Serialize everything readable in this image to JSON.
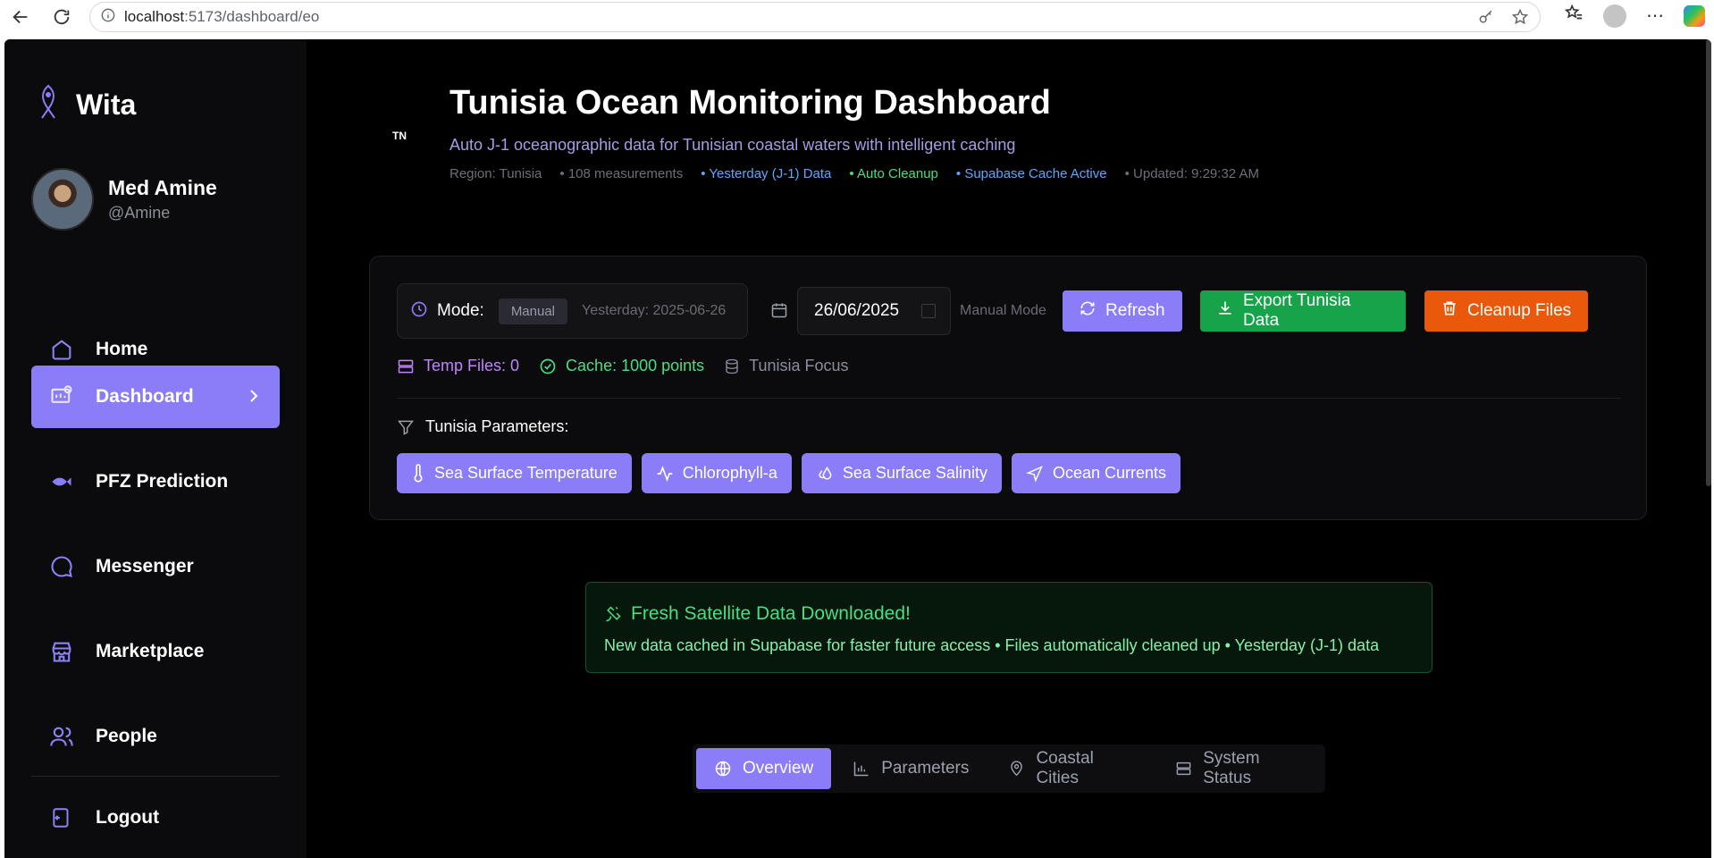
{
  "browser": {
    "url_host": "localhost",
    "url_path": ":5173/dashboard/eo"
  },
  "sidebar": {
    "brand": "Wita",
    "user": {
      "name": "Med Amine",
      "handle": "@Amine"
    },
    "items": [
      {
        "label": "Home",
        "icon": "home-icon"
      },
      {
        "label": "Dashboard",
        "icon": "dashboard-icon",
        "active": true
      },
      {
        "label": "PFZ Prediction",
        "icon": "fish-icon"
      },
      {
        "label": "Messenger",
        "icon": "chat-icon"
      },
      {
        "label": "Marketplace",
        "icon": "store-icon"
      },
      {
        "label": "People",
        "icon": "people-icon"
      }
    ],
    "logout": "Logout"
  },
  "header": {
    "badge": "TN",
    "title": "Tunisia Ocean Monitoring Dashboard",
    "subtitle": "Auto J-1 oceanographic data for Tunisian coastal waters with intelligent caching",
    "meta": {
      "region": "Region: Tunisia",
      "measurements": "108 measurements",
      "yesterday": "Yesterday (J-1) Data",
      "cleanup": "Auto Cleanup",
      "cache": "Supabase Cache Active",
      "updated": "Updated: 9:29:32 AM"
    }
  },
  "controls": {
    "mode_label": "Mode:",
    "mode_value": "Manual",
    "mode_yesterday": "Yesterday: 2025-06-26",
    "date": "26/06/2025",
    "manual_mode": "Manual Mode",
    "refresh": "Refresh",
    "export": "Export Tunisia Data",
    "cleanup": "Cleanup Files",
    "temp_files": "Temp Files: 0",
    "cache_points": "Cache: 1000 points",
    "focus": "Tunisia Focus",
    "params_label": "Tunisia Parameters:",
    "params": [
      "Sea Surface Temperature",
      "Chlorophyll-a",
      "Sea Surface Salinity",
      "Ocean Currents"
    ]
  },
  "alert": {
    "title": "Fresh Satellite Data Downloaded!",
    "body": "New data cached in Supabase for faster future access • Files automatically cleaned up • Yesterday (J-1) data"
  },
  "tabs": [
    "Overview",
    "Parameters",
    "Coastal Cities",
    "System Status"
  ],
  "colors": {
    "accent": "#8b7cf8",
    "success": "#16a34a",
    "warning": "#ea580c",
    "background": "#000000"
  }
}
